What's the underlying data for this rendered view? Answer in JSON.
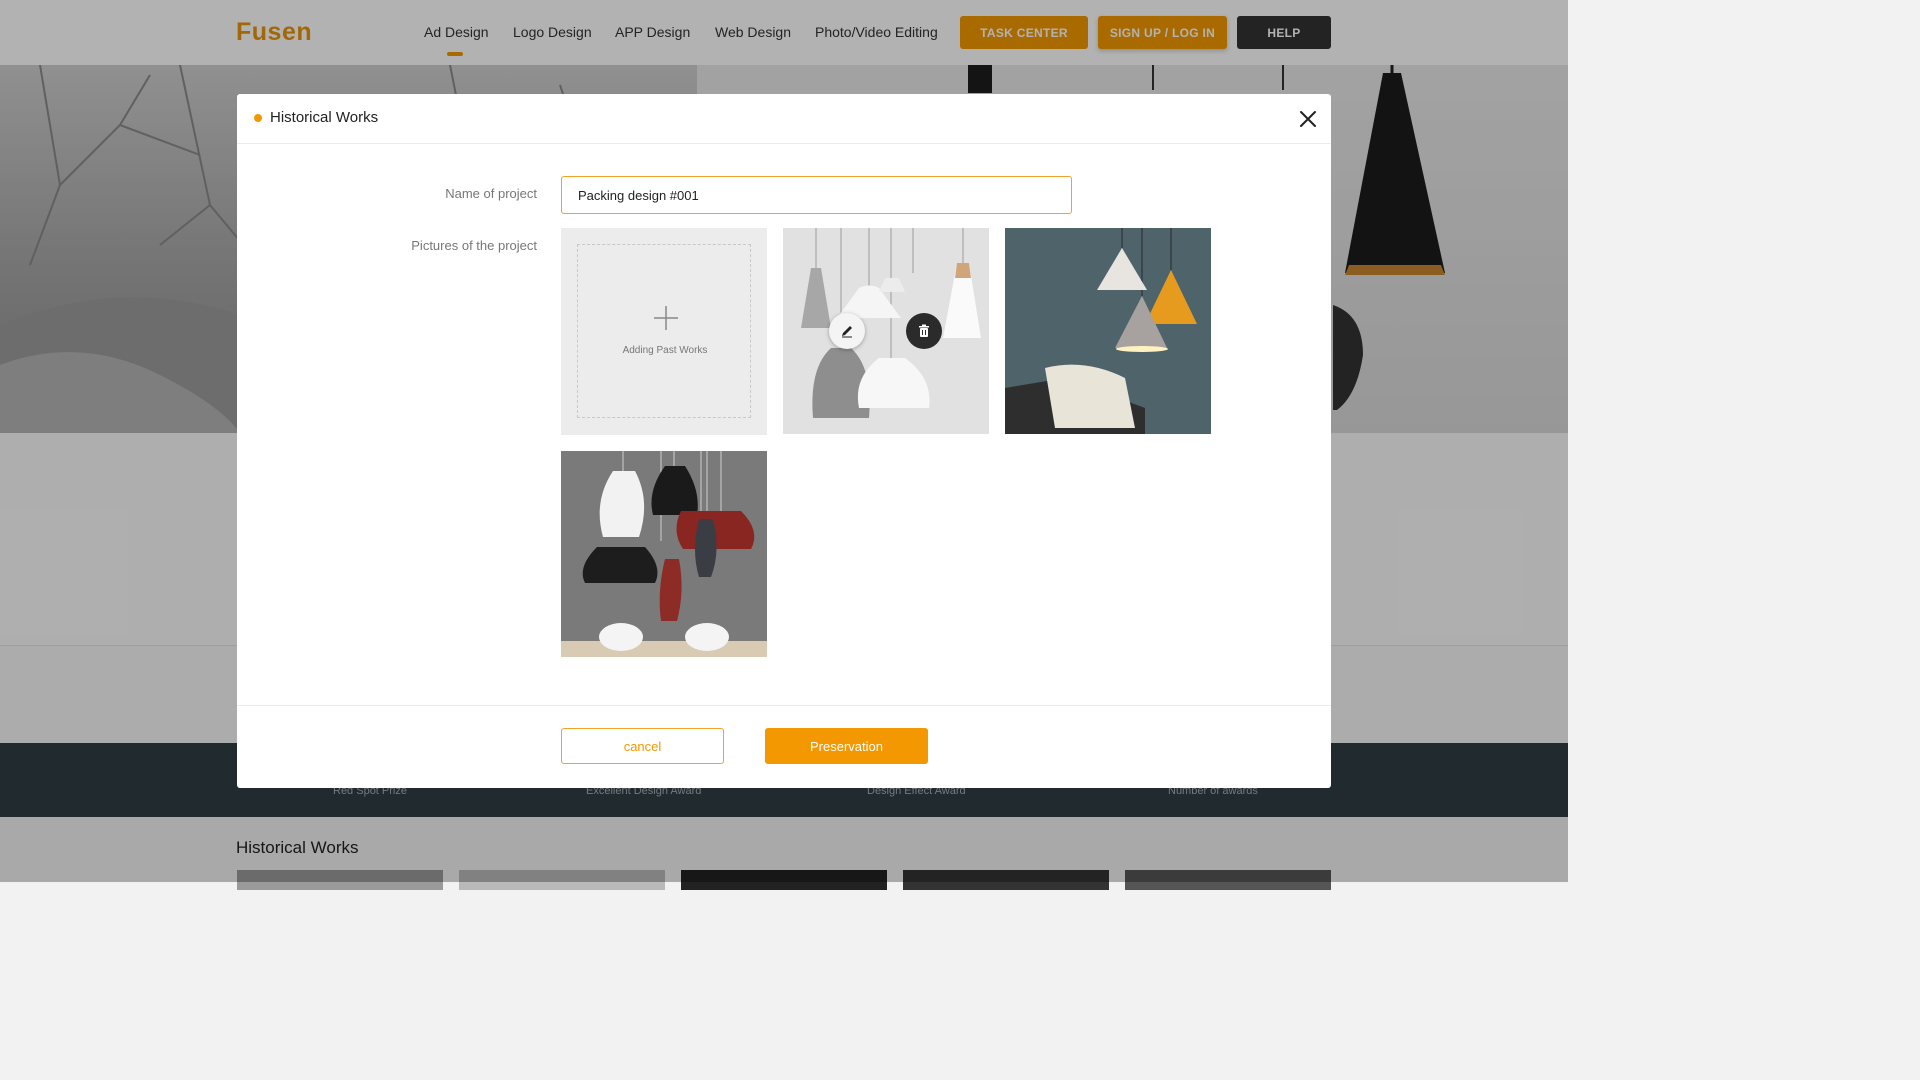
{
  "brand": {
    "logo_text": "Fusen",
    "accent_color": "#f39800"
  },
  "nav": {
    "items": [
      {
        "label": "Ad Design",
        "active": true
      },
      {
        "label": "Logo Design"
      },
      {
        "label": "APP Design"
      },
      {
        "label": "Web Design"
      },
      {
        "label": "Photo/Video Editing"
      }
    ],
    "task_center": "TASK CENTER",
    "signup": "SIGN UP / LOG IN",
    "help": "HELP"
  },
  "awards_bar": {
    "labels": [
      "Red Spot Prize",
      "Excellent Design Award",
      "Design Effect Award",
      "Number of awards"
    ]
  },
  "page_section": {
    "title": "Historical Works"
  },
  "modal": {
    "title": "Historical Works",
    "name_label": "Name of project",
    "name_value": "Packing design #001",
    "pictures_label": "Pictures of the project",
    "add_tile_text": "Adding Past Works",
    "pictures": [
      {
        "name": "grey-white-pendant-lamps",
        "icons": [
          "edit-icon",
          "trash-icon"
        ]
      },
      {
        "name": "cone-lamps-blue-wall"
      },
      {
        "name": "black-white-red-pendants"
      }
    ],
    "cancel_label": "cancel",
    "save_label": "Preservation"
  }
}
